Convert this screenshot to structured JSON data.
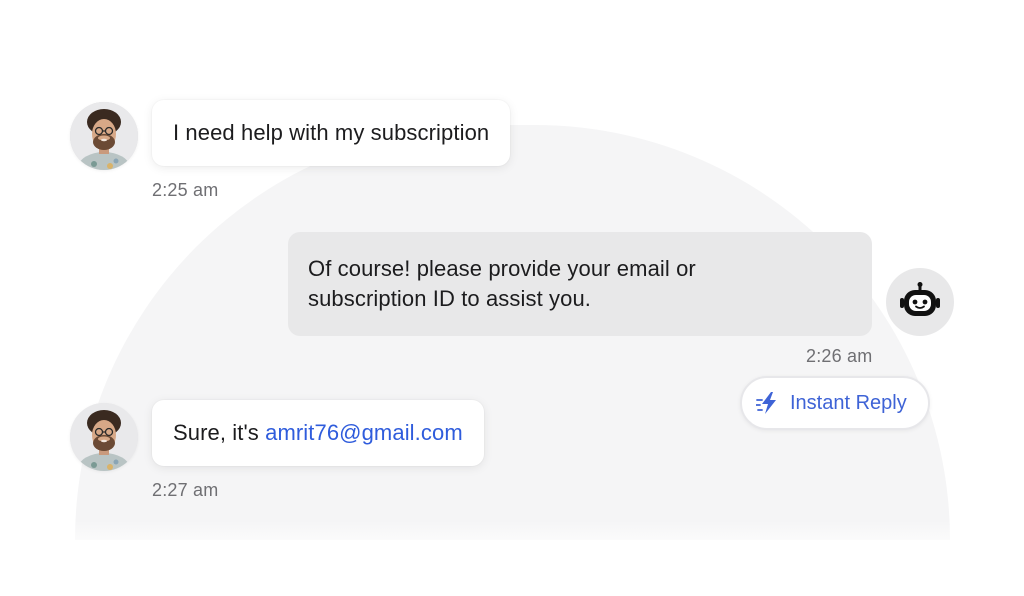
{
  "conversation": {
    "messages": [
      {
        "sender": "user",
        "text": "I need help with my subscription",
        "time": "2:25 am"
      },
      {
        "sender": "bot",
        "line1": "Of course! please provide your email or",
        "line2": "subscription ID to assist you.",
        "time": "2:26 am"
      },
      {
        "sender": "user",
        "prefix": "Sure, it's ",
        "email": "amrit76@gmail.com",
        "time": "2:27 am"
      }
    ],
    "instant_reply_label": "Instant Reply"
  },
  "colors": {
    "accent": "#3e63d6",
    "link": "#2f5cdc",
    "bot_bubble": "#e8e8e9",
    "user_bubble": "#ffffff",
    "background_dome": "#f5f5f6",
    "timestamp": "#6f6f73"
  },
  "icons": {
    "user_avatar": "user-avatar-photo",
    "bot_avatar": "robot-icon",
    "instant_reply": "lightning-bolt-icon"
  }
}
